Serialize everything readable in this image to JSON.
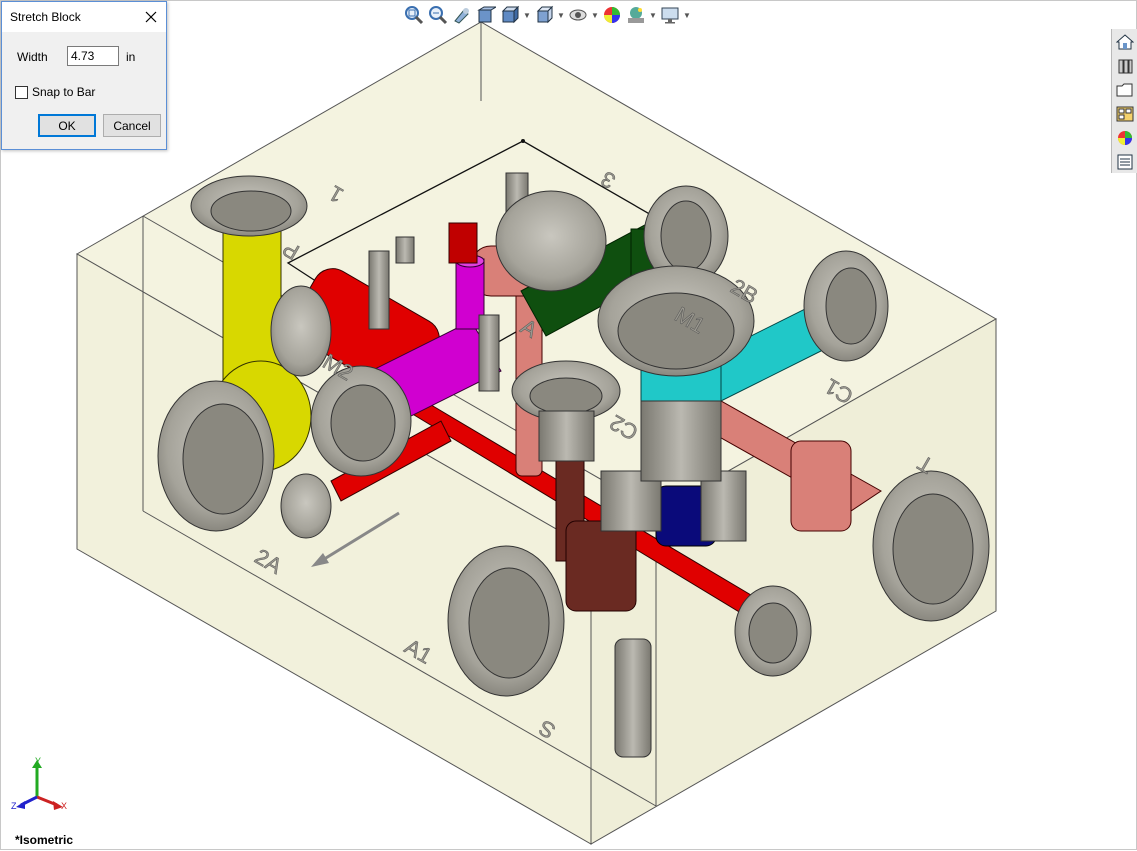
{
  "dialog": {
    "title": "Stretch Block",
    "width_label": "Width",
    "width_value": "4.73",
    "width_unit": "in",
    "snap_label": "Snap to Bar",
    "snap_checked": false,
    "ok_label": "OK",
    "cancel_label": "Cancel"
  },
  "toolbar": {
    "items": [
      "zoom-to-fit-icon",
      "zoom-to-area-icon",
      "previous-view-icon",
      "section-view-icon",
      "view-orientation-icon",
      "display-style-icon",
      "hide-show-icon",
      "edit-appearance-icon",
      "apply-scene-icon",
      "view-settings-icon"
    ]
  },
  "taskpane": {
    "items": [
      "home-icon",
      "design-library-icon",
      "file-explorer-icon",
      "view-palette-icon",
      "appearances-icon",
      "custom-properties-icon"
    ]
  },
  "viewport": {
    "view_name": "*Isometric",
    "port_labels": [
      "1",
      "3",
      "P",
      "2B",
      "M1",
      "M2",
      "A",
      "C1",
      "C2",
      "T",
      "2A",
      "A1",
      "S"
    ]
  },
  "triad": {
    "x": "X",
    "y": "Y",
    "z": "Z"
  },
  "colors": {
    "block_fill": "#f4f3e0",
    "yellow": "#d8d800",
    "red": "#e00000",
    "magenta": "#d000d0",
    "green": "#0f4f0f",
    "cyan": "#20c8c8",
    "salmon": "#d98078",
    "brown": "#6a2a22",
    "navy": "#0a0a7a",
    "metal": "#a8a69e"
  }
}
